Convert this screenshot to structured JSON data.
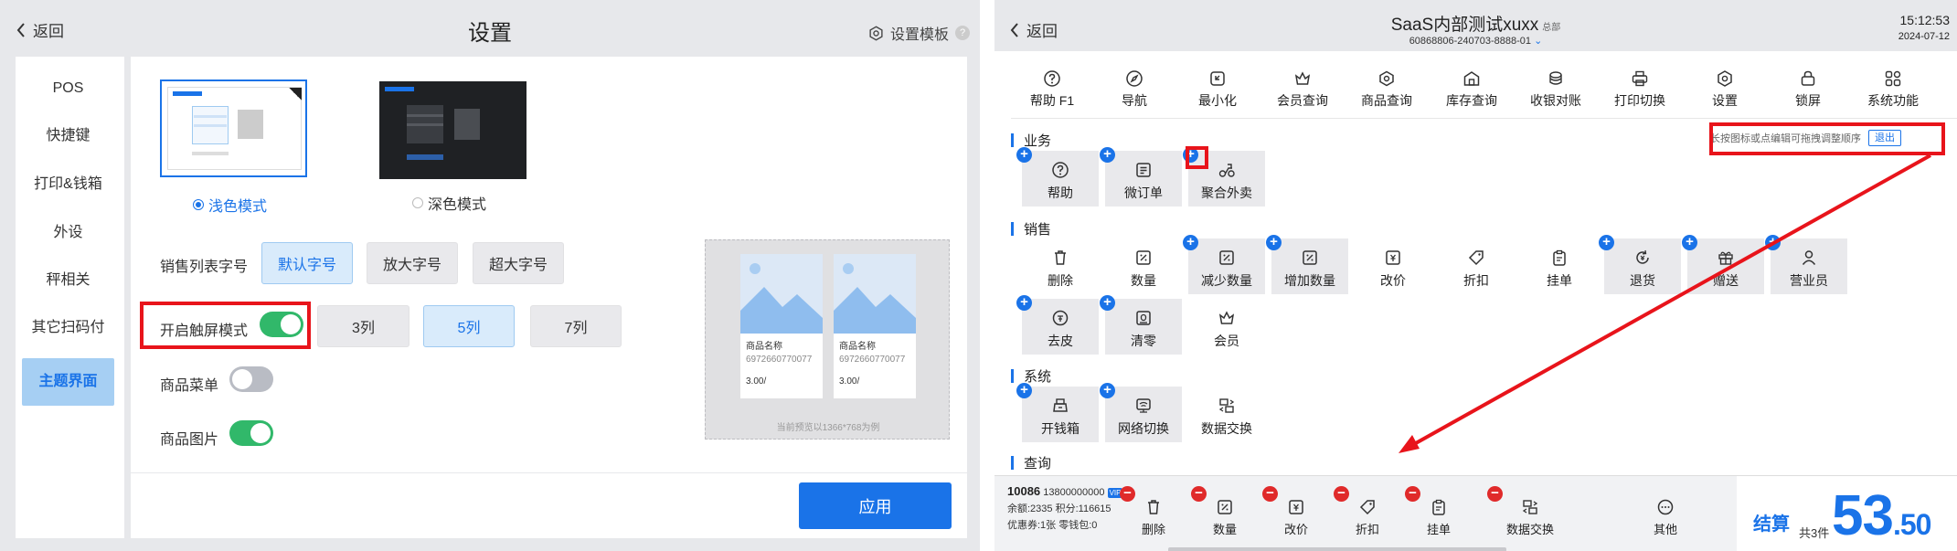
{
  "left": {
    "back_label": "返回",
    "title": "设置",
    "template_label": "设置模板",
    "help_mark": "?",
    "sidebar": [
      "POS",
      "快捷键",
      "打印&钱箱",
      "外设",
      "秤相关",
      "其它扫码付",
      "主题界面"
    ],
    "active_sidebar": "主题界面",
    "theme_light": "浅色模式",
    "theme_dark": "深色模式",
    "font_row_label": "销售列表字号",
    "font_options": [
      "默认字号",
      "放大字号",
      "超大字号"
    ],
    "font_selected": "默认字号",
    "touch_label": "开启触屏模式",
    "touch_on": true,
    "column_options": [
      "3列",
      "5列",
      "7列"
    ],
    "column_selected": "5列",
    "menu_label": "商品菜单",
    "menu_on": false,
    "image_label": "商品图片",
    "image_on": true,
    "preview": {
      "name": "商品名称",
      "code": "6972660770077",
      "price": "3.00/",
      "note": "当前预览以1366*768为例"
    },
    "apply_label": "应用"
  },
  "right": {
    "back_label": "返回",
    "store_title": "SaaS内部测试xuxx",
    "store_sub": "总部",
    "store_id": "60868806-240703-8888-01",
    "time": "15:12:53",
    "date": "2024-07-12",
    "toolbar": [
      "帮助 F1",
      "导航",
      "最小化",
      "会员查询",
      "商品查询",
      "库存查询",
      "收银对账",
      "打印切换",
      "设置",
      "锁屏",
      "系统功能"
    ],
    "hint": "长按图标或点编辑可拖拽调整顺序",
    "exit_label": "退出",
    "sections": {
      "business": "业务",
      "sales": "销售",
      "system": "系统",
      "query": "查询"
    },
    "business_tiles": [
      "帮助",
      "微订单",
      "聚合外卖"
    ],
    "sales_tiles": [
      "删除",
      "数量",
      "减少数量",
      "增加数量",
      "改价",
      "折扣",
      "挂单",
      "退货",
      "赠送",
      "营业员",
      "去皮",
      "清零",
      "会员"
    ],
    "system_tiles": [
      "开钱箱",
      "网络切换",
      "数据交换"
    ],
    "member": {
      "id": "10086",
      "phone": "13800000000",
      "vip": "VIP",
      "balance": "余额:2335",
      "points": "积分:116615",
      "coupons": "优惠券:1张",
      "wallet": "零钱包:0"
    },
    "bottom_actions": [
      "删除",
      "数量",
      "改价",
      "折扣",
      "挂单",
      "数据交换",
      "其他"
    ],
    "settle_label": "结算",
    "item_count": "共3件",
    "amount_int": "53",
    "amount_dec": ".50"
  },
  "colors": {
    "accent": "#1a73e8",
    "highlight_box": "#e8141b",
    "toggle_on": "#31b86a",
    "remove_badge": "#e02a2a"
  }
}
